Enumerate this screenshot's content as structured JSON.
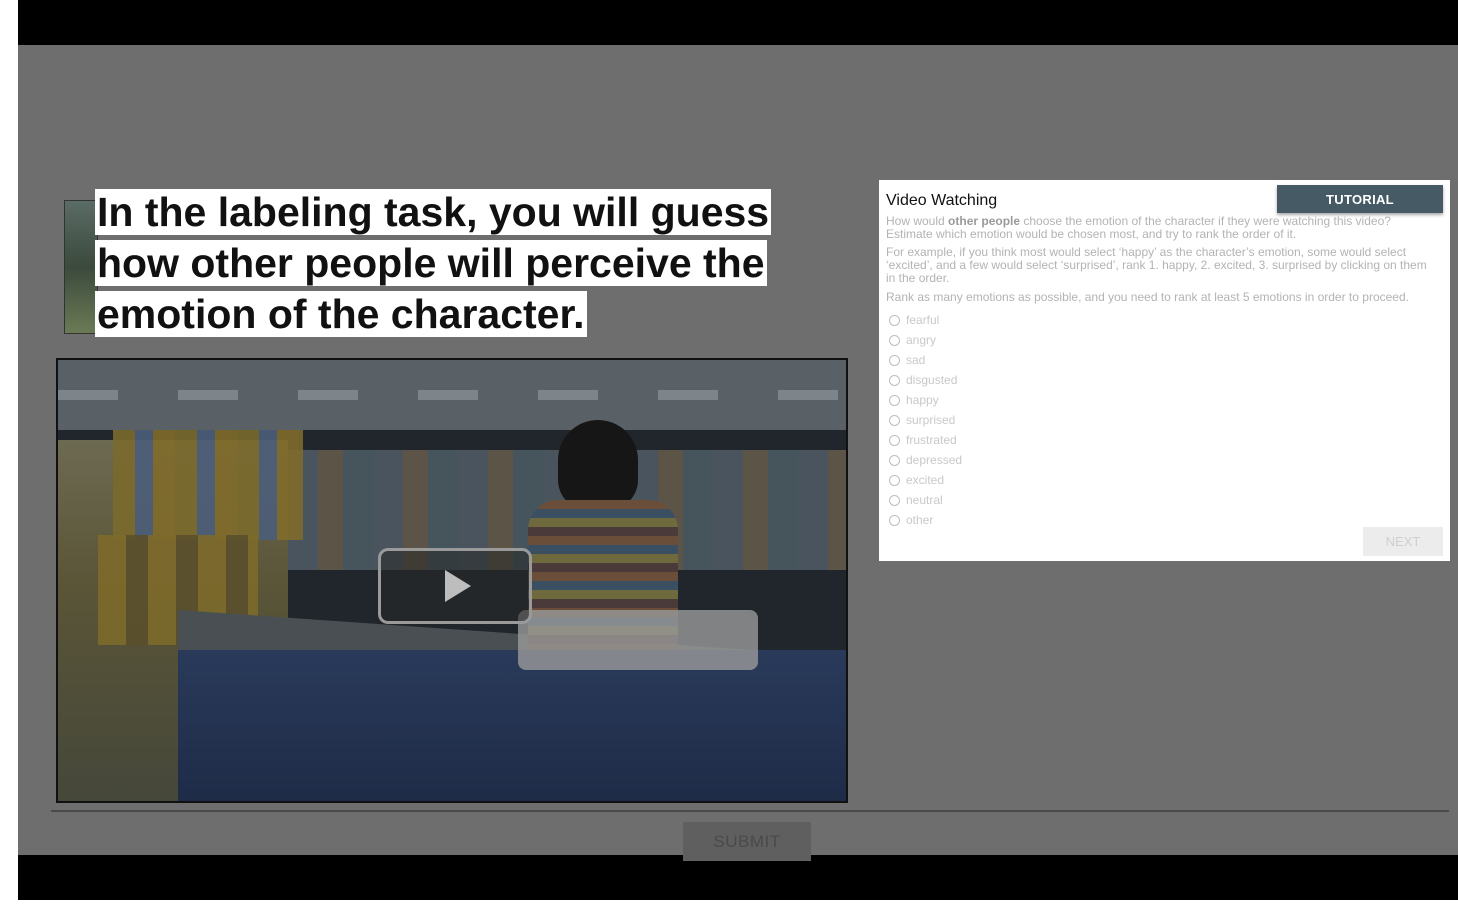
{
  "overlay": {
    "callout_text": " In the labeling task, you will guess how other people will perceive the emotion of the character."
  },
  "video": {
    "play_icon": "play-icon"
  },
  "panel": {
    "title": "Video Watching",
    "tutorial_label": "TUTORIAL",
    "instruction_1_prefix": "How would ",
    "instruction_1_bold": "other people",
    "instruction_1_suffix": " choose the emotion of the character if they were watching this video? Estimate which emotion would be chosen most, and try to rank the order of it.",
    "instruction_2": "For example, if you think most would select ‘happy’ as the character’s emotion, some would select ‘excited’, and a few would select ‘surprised’, rank 1. happy, 2. excited, 3. surprised by clicking on them in the order.",
    "instruction_3": "Rank as many emotions as possible, and you need to rank at least 5 emotions in order to proceed.",
    "options": [
      "fearful",
      "angry",
      "sad",
      "disgusted",
      "happy",
      "surprised",
      "frustrated",
      "depressed",
      "excited",
      "neutral",
      "other"
    ],
    "next_label": "NEXT"
  },
  "footer": {
    "submit_label": "SUBMIT"
  }
}
